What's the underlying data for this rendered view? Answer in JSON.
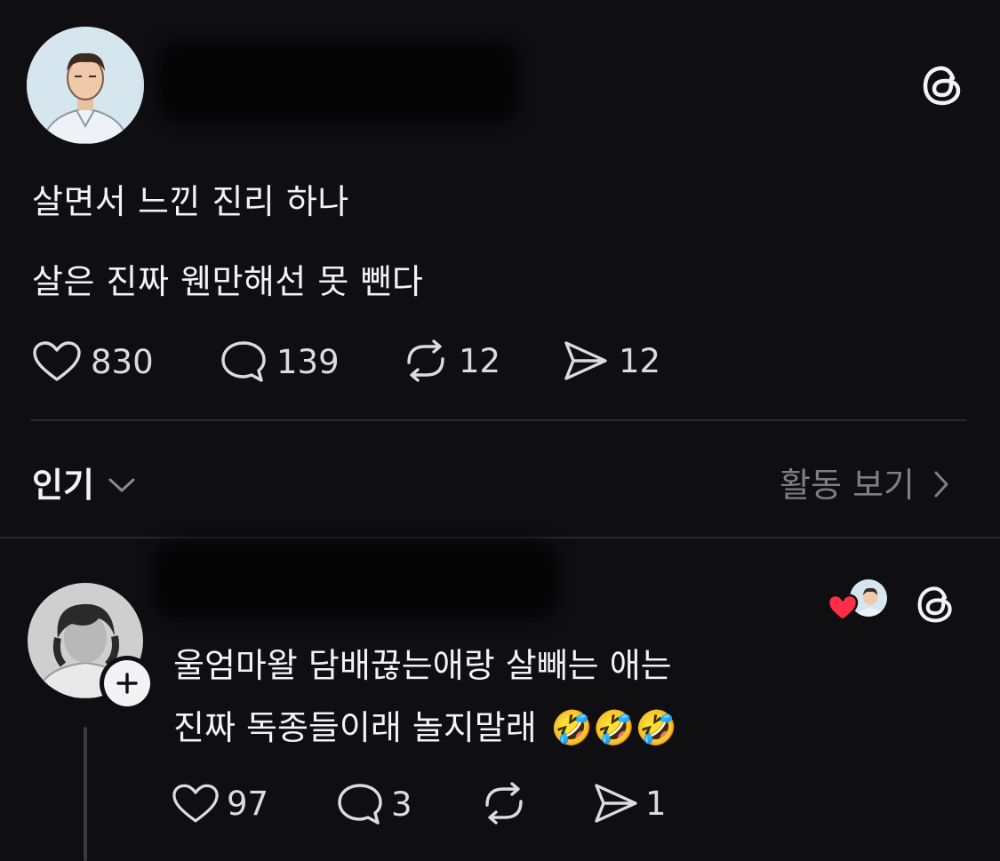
{
  "post": {
    "line1": "살면서 느낀 진리 하나",
    "line2": "살은 진짜 웬만해선 못 뺀다",
    "likes": "830",
    "replies": "139",
    "reposts": "12",
    "shares": "12"
  },
  "filter": {
    "sort_label": "인기",
    "activity_label": "활동 보기"
  },
  "reply": {
    "line1": "울엄마왈 담배끊는애랑 살빼는 애는",
    "line2": "진짜 독종들이래 놀지말래",
    "emojis": "🤣🤣🤣",
    "likes": "97",
    "replies": "3",
    "shares": "1"
  },
  "icons": {
    "brand": "threads-logo-icon",
    "like": "heart-icon",
    "reply": "speech-bubble-icon",
    "repost": "repost-icon",
    "share": "send-icon"
  },
  "colors": {
    "background": "#0f0e11",
    "text": "#f3f3f5",
    "muted": "#7e7e84",
    "like_red": "#ff2d46"
  }
}
